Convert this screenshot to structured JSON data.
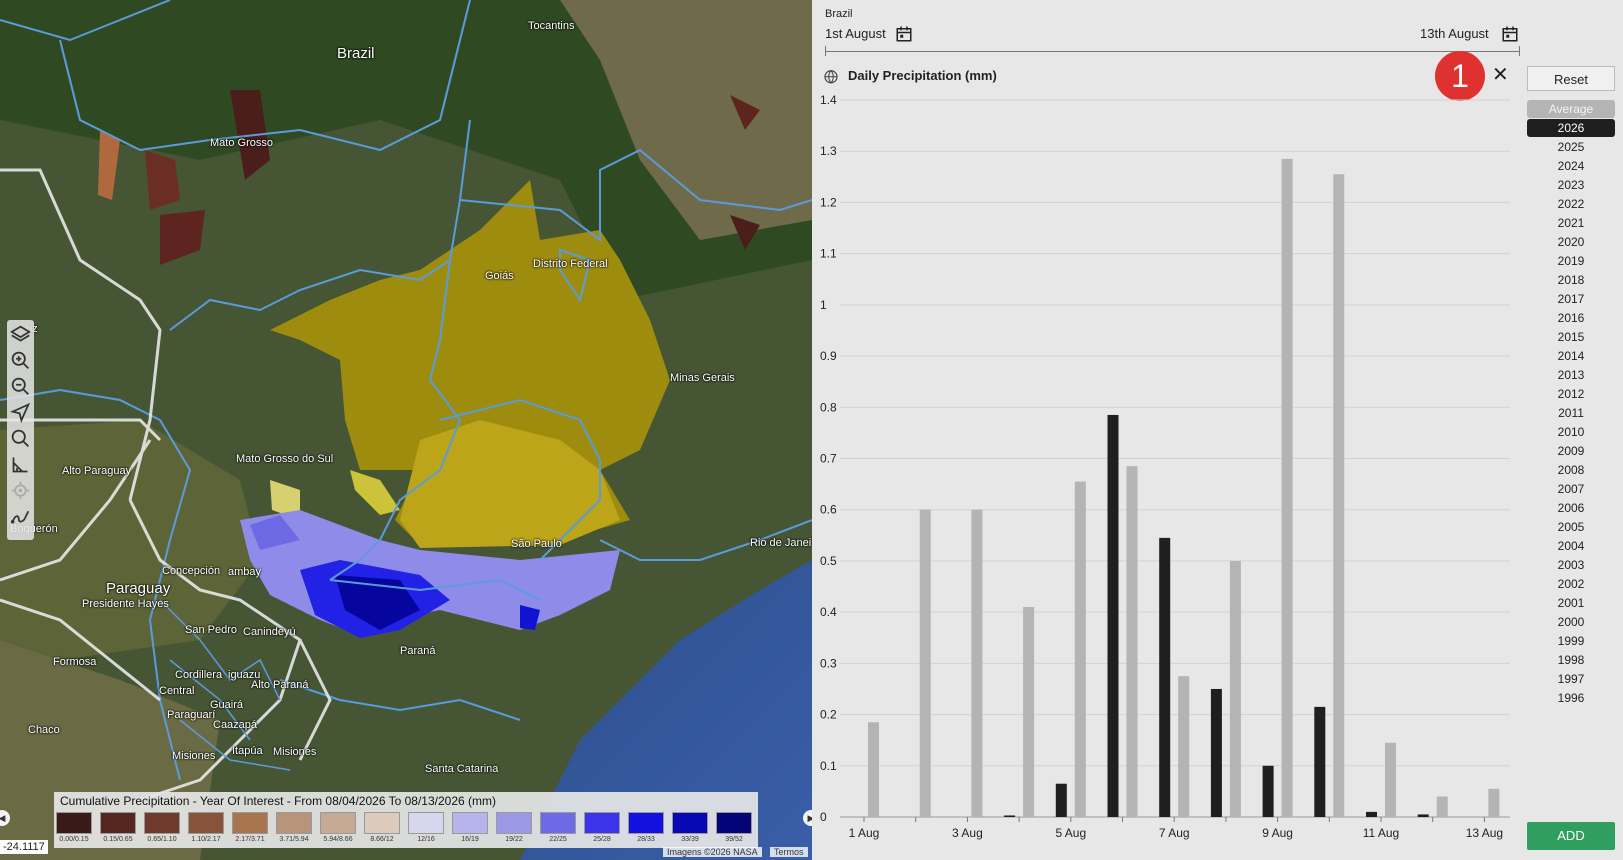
{
  "map": {
    "labels": {
      "brazil": "Brazil",
      "tocantins": "Tocantins",
      "mato_grosso": "Mato Grosso",
      "goias": "Goiás",
      "distrito_federal": "Distrito Federal",
      "minas_gerais": "Minas Gerais",
      "mato_grosso_do_sul": "Mato Grosso do Sul",
      "alto_paraguay": "Alto Paraguay",
      "sao_paulo": "São Paulo",
      "rio_de_janeiro": "Rio de Janei",
      "concepcion": "Concepción",
      "amambay": "ambay",
      "paraguay": "Paraguay",
      "presidente_hayes": "Presidente Hayes",
      "san_pedro": "San Pedro",
      "canindeyu": "Canindeyú",
      "parana": "Paraná",
      "formosa": "Formosa",
      "cordillera": "Cordillera",
      "iguazu": "iguazu",
      "central": "Central",
      "alto_parana": "Alto Paraná",
      "paraguari": "Paraguarí",
      "guaira": "Guairá",
      "caazapa": "Caazapá",
      "chaco": "Chaco",
      "itapua": "Itapúa",
      "misiones_py": "Misiones",
      "misiones_ar": "Misiones",
      "santa_catarina": "Santa Catarina",
      "boqueron": "Boquerón",
      "uz": "uz"
    },
    "coordinate": "-24.1117",
    "attribution": "Imagens ©2026 NASA",
    "terms": "Termos",
    "legend": {
      "title": "Cumulative Precipitation - Year Of Interest - From 08/04/2026 To 08/13/2026 (mm)",
      "items": [
        {
          "label": "0.00/0.15",
          "color": "#3a1a16"
        },
        {
          "label": "0.15/0.65",
          "color": "#562721"
        },
        {
          "label": "0.65/1.10",
          "color": "#6e3a2c"
        },
        {
          "label": "1.10/2.17",
          "color": "#85543a"
        },
        {
          "label": "2.17/3.71",
          "color": "#a87550"
        },
        {
          "label": "3.71/5.94",
          "color": "#b8947a"
        },
        {
          "label": "5.94/8.66",
          "color": "#c6aa94"
        },
        {
          "label": "8.66/12",
          "color": "#dccbbb"
        },
        {
          "label": "12/16",
          "color": "#d8d6ee"
        },
        {
          "label": "16/19",
          "color": "#b6b4ea"
        },
        {
          "label": "19/22",
          "color": "#9b98e6"
        },
        {
          "label": "22/25",
          "color": "#6e6ae6"
        },
        {
          "label": "25/28",
          "color": "#3a35ea"
        },
        {
          "label": "28/33",
          "color": "#1410e0"
        },
        {
          "label": "33/39",
          "color": "#0808b4"
        },
        {
          "label": "39/52",
          "color": "#040478"
        }
      ]
    }
  },
  "panel": {
    "region": "Brazil",
    "start_date": "1st August",
    "end_date": "13th August",
    "chart_title": "Daily Precipitation (mm)",
    "badge": "1",
    "close_symbol": "✕",
    "reset_label": "Reset",
    "add_label": "ADD",
    "years": [
      "Average",
      "2026",
      "2025",
      "2024",
      "2023",
      "2022",
      "2021",
      "2020",
      "2019",
      "2018",
      "2017",
      "2016",
      "2015",
      "2014",
      "2013",
      "2012",
      "2011",
      "2010",
      "2009",
      "2008",
      "2007",
      "2006",
      "2005",
      "2004",
      "2003",
      "2002",
      "2001",
      "2000",
      "1999",
      "1998",
      "1997",
      "1996"
    ],
    "selected_year": "2026"
  },
  "chart_data": {
    "type": "bar",
    "title": "Daily Precipitation (mm)",
    "categories": [
      "1 Aug",
      "2 Aug",
      "3 Aug",
      "4 Aug",
      "5 Aug",
      "6 Aug",
      "7 Aug",
      "8 Aug",
      "9 Aug",
      "10 Aug",
      "11 Aug",
      "12 Aug",
      "13 Aug"
    ],
    "x_tick_labels": [
      "1 Aug",
      "3 Aug",
      "5 Aug",
      "7 Aug",
      "9 Aug",
      "11 Aug",
      "13 Aug"
    ],
    "series": [
      {
        "name": "2026",
        "color": "#1f1f1f",
        "values": [
          0,
          0,
          0,
          0.003,
          0.065,
          0.785,
          0.545,
          0.25,
          0.1,
          0.215,
          0.01,
          0.005,
          0
        ]
      },
      {
        "name": "Average",
        "color": "#b4b4b4",
        "values": [
          0.185,
          0.6,
          0.6,
          0.41,
          0.655,
          0.685,
          0.275,
          0.5,
          1.285,
          1.255,
          0.145,
          0.04,
          0.055
        ]
      }
    ],
    "ylim": [
      0,
      1.4
    ],
    "y_ticks": [
      0,
      0.1,
      0.2,
      0.3,
      0.4,
      0.5,
      0.6,
      0.7,
      0.8,
      0.9,
      1,
      1.1,
      1.2,
      1.3,
      1.4
    ],
    "grid": true
  }
}
